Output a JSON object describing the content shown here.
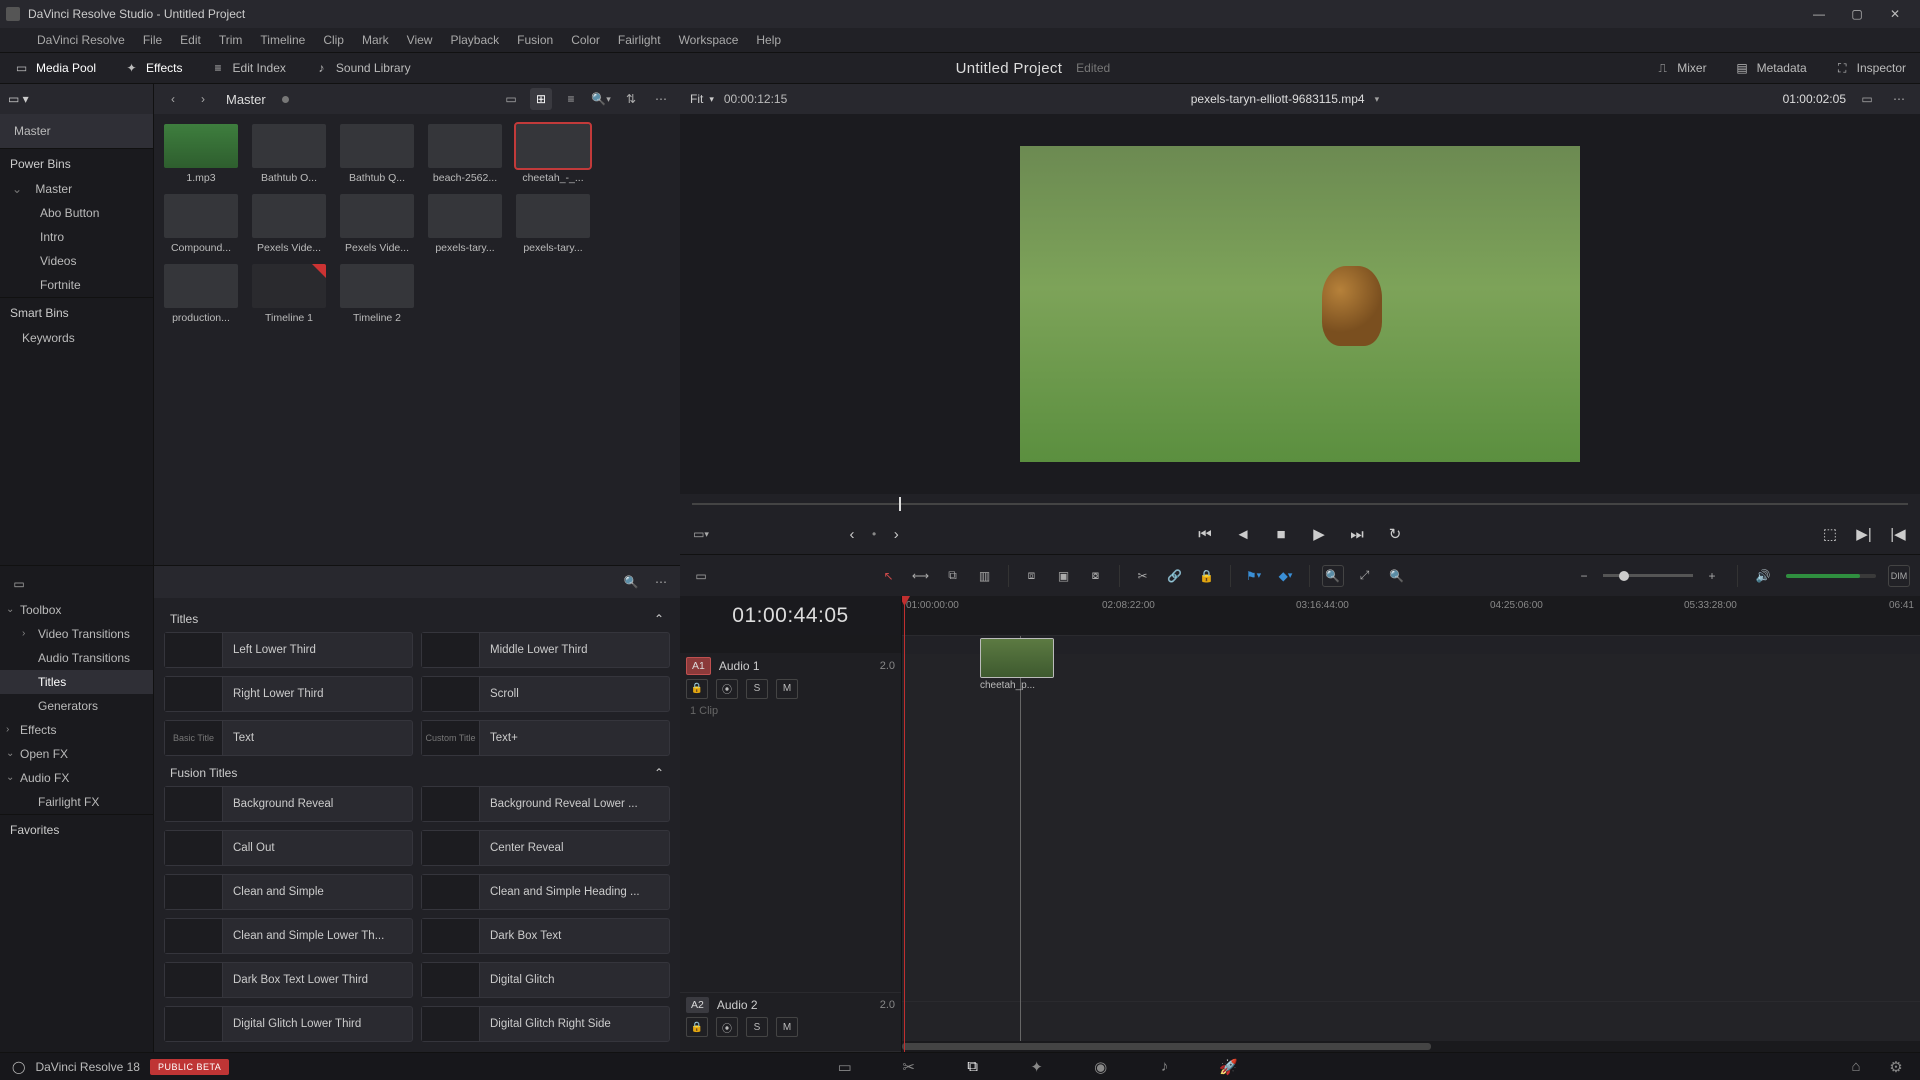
{
  "titlebar": {
    "text": "DaVinci Resolve Studio - Untitled Project"
  },
  "menu": [
    "DaVinci Resolve",
    "File",
    "Edit",
    "Trim",
    "Timeline",
    "Clip",
    "Mark",
    "View",
    "Playback",
    "Fusion",
    "Color",
    "Fairlight",
    "Workspace",
    "Help"
  ],
  "panels": {
    "mediaPool": "Media Pool",
    "effects": "Effects",
    "editIndex": "Edit Index",
    "soundLib": "Sound Library",
    "mixer": "Mixer",
    "metadata": "Metadata",
    "inspector": "Inspector"
  },
  "project": {
    "name": "Untitled Project",
    "status": "Edited"
  },
  "binTree": {
    "current": "Master",
    "root": "Master",
    "powerBins": {
      "label": "Power Bins",
      "master": "Master",
      "children": [
        "Abo Button",
        "Intro",
        "Videos",
        "Fortnite"
      ]
    },
    "smartBins": {
      "label": "Smart Bins",
      "items": [
        "Keywords"
      ]
    }
  },
  "mediaGrid": {
    "label": "Master",
    "items": [
      {
        "name": "1.mp3",
        "audio": true
      },
      {
        "name": "Bathtub O..."
      },
      {
        "name": "Bathtub Q..."
      },
      {
        "name": "beach-2562..."
      },
      {
        "name": "cheetah_-_...",
        "selected": true
      },
      {
        "name": "Compound..."
      },
      {
        "name": "Pexels Vide..."
      },
      {
        "name": "Pexels Vide..."
      },
      {
        "name": "pexels-tary..."
      },
      {
        "name": "pexels-tary..."
      },
      {
        "name": "production..."
      },
      {
        "name": "Timeline 1",
        "tl": true
      },
      {
        "name": "Timeline 2"
      }
    ]
  },
  "effectsTree": {
    "toolbox": "Toolbox",
    "items": [
      "Video Transitions",
      "Audio Transitions",
      "Titles",
      "Generators",
      "Effects"
    ],
    "selected": "Titles",
    "openfx": "Open FX",
    "audiofx": "Audio FX",
    "fairlightfx": "Fairlight FX",
    "favorites": "Favorites"
  },
  "titles": {
    "group": "Titles",
    "list": [
      "Left Lower Third",
      "Middle Lower Third",
      "Right Lower Third",
      "Scroll",
      "Text",
      "Text+"
    ],
    "pvLabels": [
      "",
      "",
      "",
      "",
      "Basic Title",
      "Custom Title"
    ]
  },
  "fusionTitles": {
    "group": "Fusion Titles",
    "list": [
      "Background Reveal",
      "Background Reveal Lower ...",
      "Call Out",
      "Center Reveal",
      "Clean and Simple",
      "Clean and Simple Heading ...",
      "Clean and Simple Lower Th...",
      "Dark Box Text",
      "Dark Box Text Lower Third",
      "Digital Glitch",
      "Digital Glitch Lower Third",
      "Digital Glitch Right Side"
    ]
  },
  "viewer": {
    "fit": "Fit",
    "srcTC": "00:00:12:15",
    "clipName": "pexels-taryn-elliott-9683115.mp4",
    "clipTC": "01:00:02:05"
  },
  "timeline": {
    "tc": "01:00:44:05",
    "marks": [
      "01:00:00:00",
      "02:08:22:00",
      "03:16:44:00",
      "04:25:06:00",
      "05:33:28:00",
      "06:41"
    ],
    "tracks": {
      "a1": {
        "tag": "A1",
        "name": "Audio 1",
        "val": "2.0",
        "clips": "1 Clip",
        "s": "S",
        "m": "M"
      },
      "a2": {
        "tag": "A2",
        "name": "Audio 2",
        "val": "2.0",
        "s": "S",
        "m": "M"
      }
    },
    "clipLabel": "cheetah_p...",
    "dim": "DIM"
  },
  "footer": {
    "ver": "DaVinci Resolve 18",
    "badge": "PUBLIC BETA"
  }
}
